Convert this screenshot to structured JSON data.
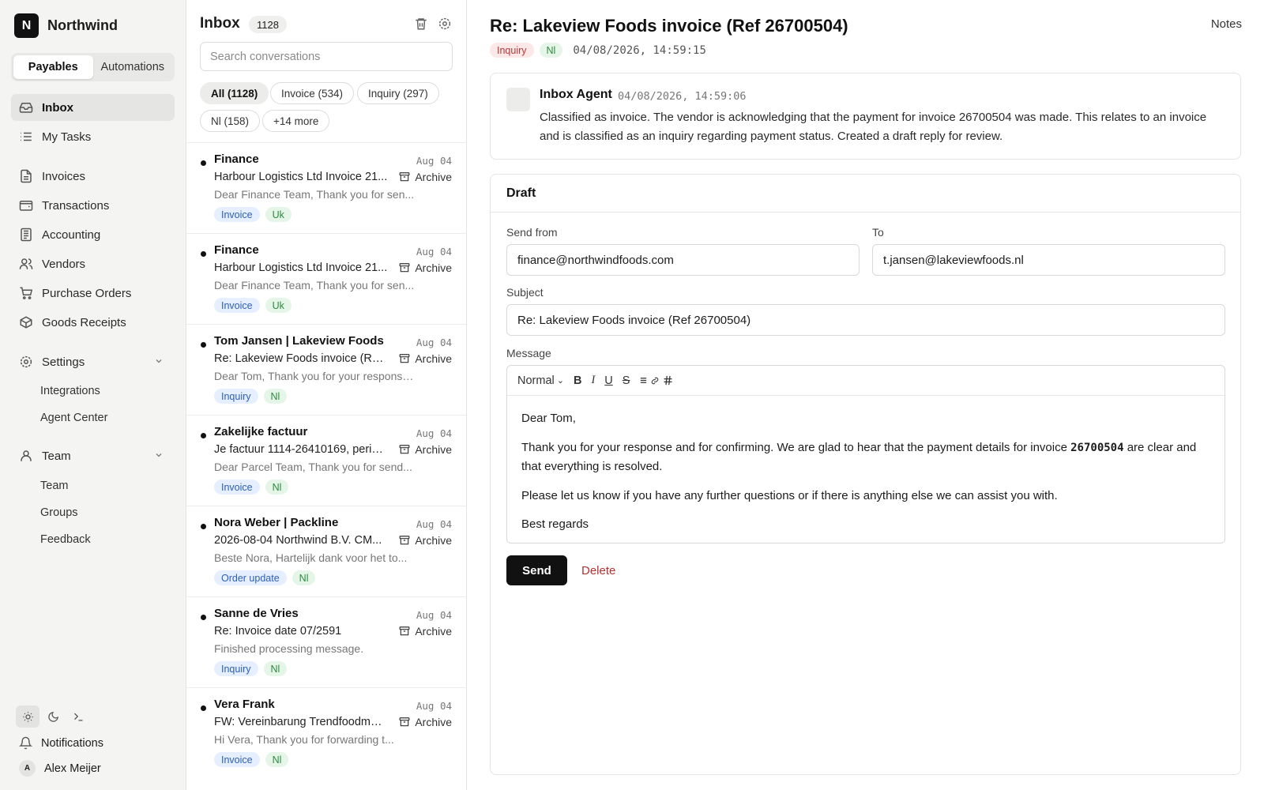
{
  "brand": {
    "logo_letter": "N",
    "name": "Northwind"
  },
  "workspace_tabs": [
    "Payables",
    "Automations"
  ],
  "nav": {
    "inbox": "Inbox",
    "my_tasks": "My Tasks",
    "invoices": "Invoices",
    "transactions": "Transactions",
    "accounting": "Accounting",
    "vendors": "Vendors",
    "purchase_orders": "Purchase Orders",
    "goods_receipts": "Goods Receipts",
    "settings": "Settings",
    "settings_items": [
      "Integrations",
      "Agent Center"
    ],
    "team": "Team",
    "team_items": [
      "Team",
      "Groups",
      "Feedback"
    ]
  },
  "footer": {
    "notifications": "Notifications",
    "user_initial": "A",
    "user_name": "Alex Meijer"
  },
  "inbox": {
    "title": "Inbox",
    "count": "1128",
    "search_placeholder": "Search conversations",
    "filters": [
      "All (1128)",
      "Invoice (534)",
      "Inquiry (297)",
      "Nl (158)",
      "+14 more"
    ],
    "archive_label": "Archive",
    "messages": [
      {
        "sender": "Finance",
        "date": "Aug 04",
        "subject": "Harbour Logistics Ltd Invoice 21...",
        "preview": "Dear Finance Team, Thank you for sen...",
        "tags": [
          {
            "label": "Invoice",
            "color": "blue"
          },
          {
            "label": "Uk",
            "color": "green"
          }
        ]
      },
      {
        "sender": "Finance",
        "date": "Aug 04",
        "subject": "Harbour Logistics Ltd Invoice 21...",
        "preview": "Dear Finance Team, Thank you for sen...",
        "tags": [
          {
            "label": "Invoice",
            "color": "blue"
          },
          {
            "label": "Uk",
            "color": "green"
          }
        ]
      },
      {
        "sender": "Tom Jansen | Lakeview Foods",
        "date": "Aug 04",
        "subject": "Re: Lakeview Foods invoice (Ref...",
        "preview": "Dear Tom, Thank you for your response...",
        "tags": [
          {
            "label": "Inquiry",
            "color": "blue"
          },
          {
            "label": "Nl",
            "color": "green"
          }
        ]
      },
      {
        "sender": "Zakelijke factuur",
        "date": "Aug 04",
        "subject": "Je factuur 1114-26410169, period...",
        "preview": "Dear Parcel Team, Thank you for send...",
        "tags": [
          {
            "label": "Invoice",
            "color": "blue"
          },
          {
            "label": "Nl",
            "color": "green"
          }
        ]
      },
      {
        "sender": "Nora Weber | Packline",
        "date": "Aug 04",
        "subject": "2026-08-04 Northwind B.V. CM...",
        "preview": "Beste Nora, Hartelijk dank voor het to...",
        "tags": [
          {
            "label": "Order update",
            "color": "blue"
          },
          {
            "label": "Nl",
            "color": "green"
          }
        ]
      },
      {
        "sender": "Sanne de Vries",
        "date": "Aug 04",
        "subject": "Re: Invoice date 07/2591",
        "preview": "Finished processing message.",
        "tags": [
          {
            "label": "Inquiry",
            "color": "blue"
          },
          {
            "label": "Nl",
            "color": "green"
          }
        ]
      },
      {
        "sender": "Vera Frank",
        "date": "Aug 04",
        "subject": "FW: Vereinbarung Trendfoodmar...",
        "preview": "Hi Vera, Thank you for forwarding t...",
        "tags": [
          {
            "label": "Invoice",
            "color": "blue"
          },
          {
            "label": "Nl",
            "color": "green"
          }
        ]
      }
    ]
  },
  "detail": {
    "title": "Re: Lakeview Foods invoice (Ref 26700504)",
    "notes": "Notes",
    "tags": [
      {
        "label": "Inquiry",
        "color": "red"
      },
      {
        "label": "Nl",
        "color": "green"
      }
    ],
    "timestamp": "04/08/2026, 14:59:15",
    "agent": {
      "name": "Inbox Agent",
      "timestamp": "04/08/2026, 14:59:06",
      "text": "Classified as invoice. The vendor is acknowledging that the payment for invoice 26700504 was made. This relates to an invoice and is classified as an inquiry regarding payment status. Created a draft reply for review."
    },
    "draft": {
      "heading": "Draft",
      "send_from_label": "Send from",
      "send_from_value": "finance@northwindfoods.com",
      "to_label": "To",
      "to_value": "t.jansen@lakeviewfoods.nl",
      "subject_label": "Subject",
      "subject_value": "Re: Lakeview Foods invoice (Ref 26700504)",
      "message_label": "Message",
      "toolbar": {
        "style": "Normal",
        "bold": "B",
        "italic": "I",
        "underline": "U",
        "strike": "S"
      },
      "body": {
        "greeting": "Dear Tom,",
        "p1_before": "Thank you for your response and for confirming. We are glad to hear that the payment details for invoice ",
        "p1_invoice": "26700504",
        "p1_after": " are clear and that everything is resolved.",
        "p2": "Please let us know if you have any further questions or if there is anything else we can assist you with.",
        "closing": "Best regards"
      },
      "send_label": "Send",
      "delete_label": "Delete"
    }
  }
}
